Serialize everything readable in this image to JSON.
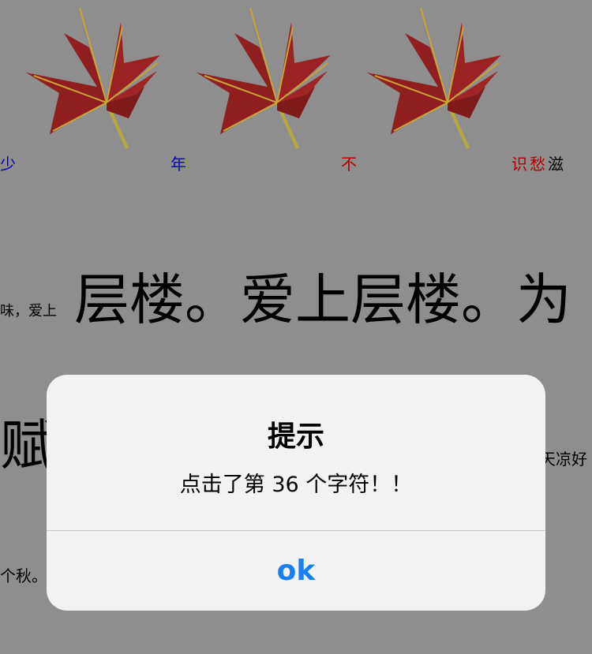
{
  "row1": {
    "chars": [
      "少",
      "年",
      "不",
      "识",
      "愁",
      "滋"
    ]
  },
  "row2": {
    "prefix": "味，爱上",
    "big": "层楼。爱上层楼。为"
  },
  "row3": {
    "big": "赋",
    "suffix": "天凉好"
  },
  "row4": {
    "text": "个秋。"
  },
  "colors": {
    "background": "#8e8e8e",
    "blue_char": "#0000c0",
    "red_char": "#b00000",
    "dialog_bg": "#f2f2f2",
    "button_blue": "#1a7ff0"
  },
  "dialog": {
    "title": "提示",
    "message": "点击了第 36 个字符！！",
    "ok_label": "ok"
  }
}
